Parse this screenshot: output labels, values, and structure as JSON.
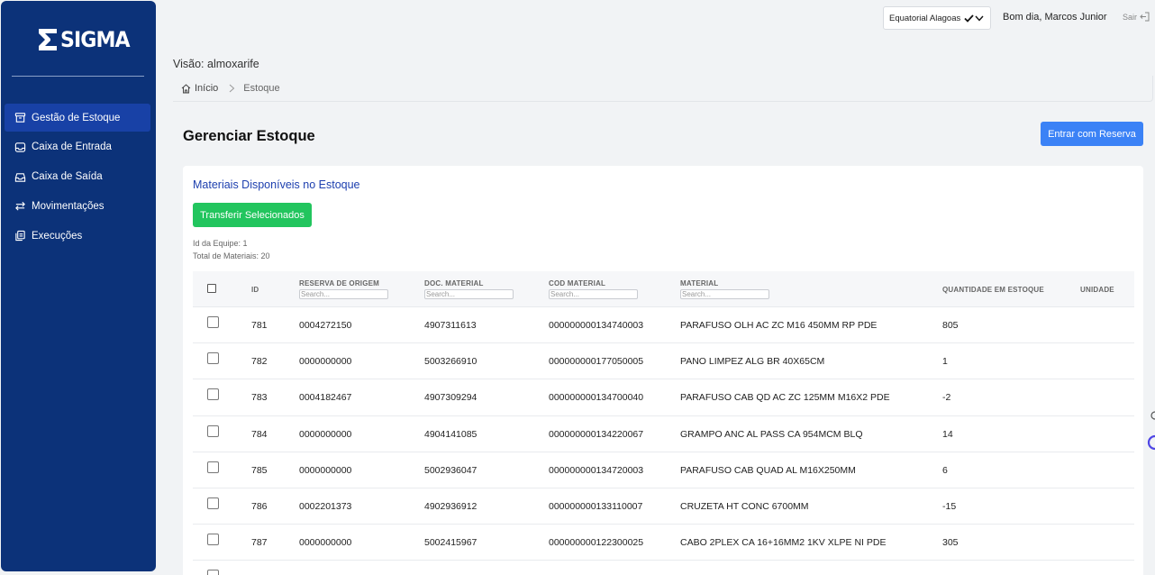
{
  "app": {
    "logo_text": "SIGMA"
  },
  "sidebar": {
    "items": [
      {
        "label": "Gestão de Estoque",
        "icon": "box-icon",
        "active": true
      },
      {
        "label": "Caixa de Entrada",
        "icon": "inbox-icon",
        "active": false
      },
      {
        "label": "Caixa de Saída",
        "icon": "outbox-icon",
        "active": false
      },
      {
        "label": "Movimentações",
        "icon": "arrows-swap-icon",
        "active": false
      },
      {
        "label": "Execuções",
        "icon": "clipboard-icon",
        "active": false
      }
    ]
  },
  "topbar": {
    "company": "Equatorial Alagoas",
    "greeting": "Bom dia, Marcos Junior",
    "logout": "Sair"
  },
  "header": {
    "vision": "Visão: almoxarife",
    "breadcrumb": {
      "home": "Início",
      "current": "Estoque"
    }
  },
  "page": {
    "title": "Gerenciar Estoque",
    "reserve_button": "Entrar com Reserva"
  },
  "card": {
    "title": "Materiais Disponíveis no Estoque",
    "transfer_button": "Transferir Selecionados",
    "team_id": "Id da Equipe: 1",
    "total": "Total de Materiais: 20"
  },
  "table": {
    "columns": {
      "id": "ID",
      "reserva": "RESERVA DE ORIGEM",
      "doc": "DOC. MATERIAL",
      "cod": "COD MATERIAL",
      "material": "MATERIAL",
      "quantidade": "QUANTIDADE EM ESTOQUE",
      "unidade": "UNIDADE"
    },
    "search_placeholder": "Search...",
    "rows": [
      {
        "id": "781",
        "reserva": "0004272150",
        "doc": "4907311613",
        "cod": "000000000134740003",
        "material": "PARAFUSO OLH AC ZC M16 450MM RP PDE",
        "qty": "805",
        "un": ""
      },
      {
        "id": "782",
        "reserva": "0000000000",
        "doc": "5003266910",
        "cod": "000000000177050005",
        "material": "PANO LIMPEZ ALG BR 40X65CM",
        "qty": "1",
        "un": ""
      },
      {
        "id": "783",
        "reserva": "0004182467",
        "doc": "4907309294",
        "cod": "000000000134700040",
        "material": "PARAFUSO CAB QD AC ZC 125MM M16X2 PDE",
        "qty": "-2",
        "un": ""
      },
      {
        "id": "784",
        "reserva": "0000000000",
        "doc": "4904141085",
        "cod": "000000000134220067",
        "material": "GRAMPO ANC AL PASS CA 954MCM BLQ",
        "qty": "14",
        "un": ""
      },
      {
        "id": "785",
        "reserva": "0000000000",
        "doc": "5002936047",
        "cod": "000000000134720003",
        "material": "PARAFUSO CAB QUAD AL M16X250MM",
        "qty": "6",
        "un": ""
      },
      {
        "id": "786",
        "reserva": "0002201373",
        "doc": "4902936912",
        "cod": "000000000133110007",
        "material": "CRUZETA HT CONC 6700MM",
        "qty": "-15",
        "un": ""
      },
      {
        "id": "787",
        "reserva": "0000000000",
        "doc": "5002415967",
        "cod": "000000000122300025",
        "material": "CABO 2PLEX CA 16+16MM2 1KV XLPE NI PDE",
        "qty": "305",
        "un": ""
      }
    ]
  }
}
